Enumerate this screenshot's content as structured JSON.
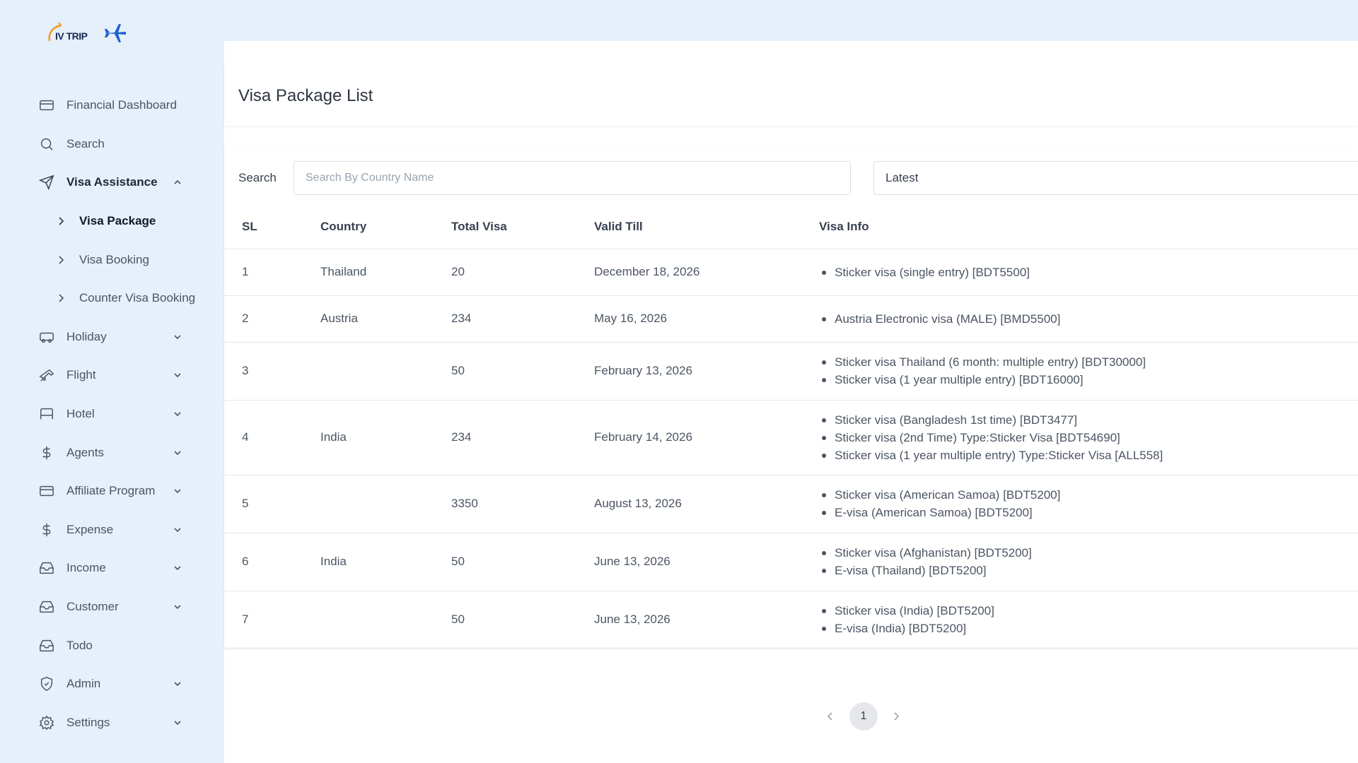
{
  "brand": {
    "logo_text": "IV TRIP"
  },
  "sidebar": {
    "items": [
      {
        "label": "Financial Dashboard",
        "icon": "card-icon",
        "has_chevron": false
      },
      {
        "label": "Search",
        "icon": "search-icon",
        "has_chevron": false
      },
      {
        "label": "Visa Assistance",
        "icon": "send-icon",
        "has_chevron": true,
        "expanded": true,
        "children": [
          {
            "label": "Visa Package",
            "active": true
          },
          {
            "label": "Visa Booking",
            "active": false
          },
          {
            "label": "Counter Visa Booking",
            "active": false
          }
        ]
      },
      {
        "label": "Holiday",
        "icon": "bus-icon",
        "has_chevron": true
      },
      {
        "label": "Flight",
        "icon": "plane-icon",
        "has_chevron": true
      },
      {
        "label": "Hotel",
        "icon": "bed-icon",
        "has_chevron": true
      },
      {
        "label": "Agents",
        "icon": "dollar-icon",
        "has_chevron": true
      },
      {
        "label": "Affiliate Program",
        "icon": "card-icon",
        "has_chevron": true
      },
      {
        "label": "Expense",
        "icon": "dollar-icon",
        "has_chevron": true
      },
      {
        "label": "Income",
        "icon": "inbox-icon",
        "has_chevron": true
      },
      {
        "label": "Customer",
        "icon": "inbox-icon",
        "has_chevron": true
      },
      {
        "label": "Todo",
        "icon": "inbox-icon",
        "has_chevron": false
      },
      {
        "label": "Admin",
        "icon": "shield-icon",
        "has_chevron": true
      },
      {
        "label": "Settings",
        "icon": "gear-icon",
        "has_chevron": true
      }
    ]
  },
  "page": {
    "title": "Visa Package List"
  },
  "filters": {
    "search_label": "Search",
    "search_placeholder": "Search By Country Name",
    "sort_value": "Latest"
  },
  "table": {
    "headers": {
      "sl": "SL",
      "country": "Country",
      "total": "Total Visa",
      "valid": "Valid Till",
      "info": "Visa Info"
    },
    "rows": [
      {
        "sl": "1",
        "country": "Thailand",
        "total": "20",
        "valid": "December 18, 2026",
        "info": [
          "Sticker visa (single entry) [BDT5500]"
        ]
      },
      {
        "sl": "2",
        "country": "Austria",
        "total": "234",
        "valid": "May 16, 2026",
        "info": [
          "Austria Electronic visa (MALE) [BMD5500]"
        ]
      },
      {
        "sl": "3",
        "country": "",
        "total": "50",
        "valid": "February 13, 2026",
        "info": [
          "Sticker visa Thailand (6 month: multiple entry) [BDT30000]",
          "Sticker visa (1 year multiple entry) [BDT16000]"
        ]
      },
      {
        "sl": "4",
        "country": "India",
        "total": "234",
        "valid": "February 14, 2026",
        "info": [
          "Sticker visa (Bangladesh 1st time) [BDT3477]",
          "Sticker visa (2nd Time) Type:Sticker Visa [BDT54690]",
          "Sticker visa (1 year multiple entry) Type:Sticker Visa [ALL558]"
        ]
      },
      {
        "sl": "5",
        "country": "",
        "total": "3350",
        "valid": "August 13, 2026",
        "info": [
          "Sticker visa (American Samoa) [BDT5200]",
          "E-visa (American Samoa) [BDT5200]"
        ]
      },
      {
        "sl": "6",
        "country": "India",
        "total": "50",
        "valid": "June 13, 2026",
        "info": [
          "Sticker visa (Afghanistan) [BDT5200]",
          "E-visa (Thailand) [BDT5200]"
        ]
      },
      {
        "sl": "7",
        "country": "",
        "total": "50",
        "valid": "June 13, 2026",
        "info": [
          "Sticker visa (India) [BDT5200]",
          "E-visa (India) [BDT5200]"
        ]
      }
    ]
  },
  "pagination": {
    "current_page": "1"
  }
}
